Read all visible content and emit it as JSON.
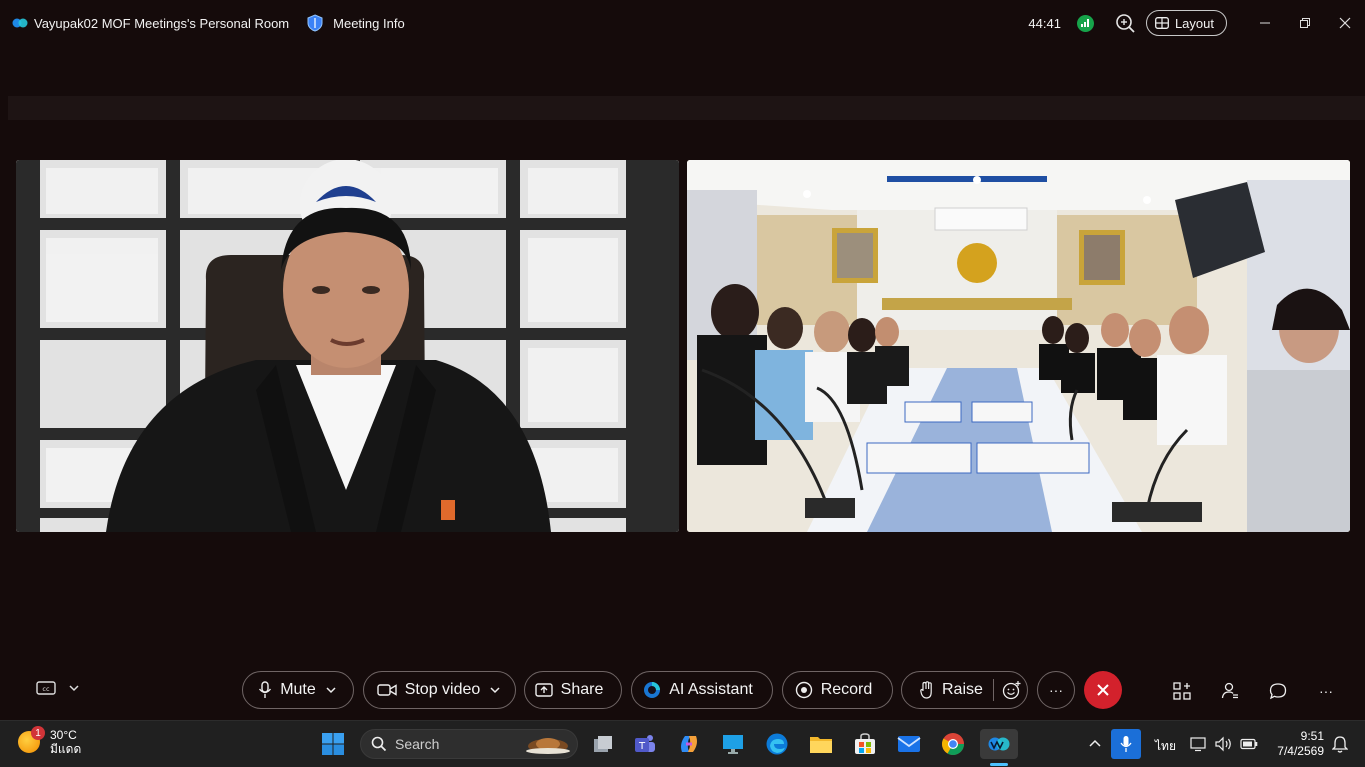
{
  "titlebar": {
    "meeting_title": "Vayupak02 MOF Meetings's Personal Room",
    "meeting_info_label": "Meeting Info",
    "timer": "44:41",
    "layout_label": "Layout"
  },
  "controls": {
    "mute_label": "Mute",
    "stop_video_label": "Stop video",
    "share_label": "Share",
    "ai_assistant_label": "AI Assistant",
    "record_label": "Record",
    "raise_label": "Raise",
    "more_label": "···"
  },
  "taskbar": {
    "weather_badge": "1",
    "weather_temp": "30°C",
    "weather_desc": "มีแดด",
    "search_placeholder": "Search",
    "language": "ไทย",
    "time": "9:51",
    "date": "7/4/2569"
  },
  "colors": {
    "background": "#150b0b",
    "end_call": "#d3212c",
    "signal": "#16a34a",
    "taskbar": "#202020"
  }
}
